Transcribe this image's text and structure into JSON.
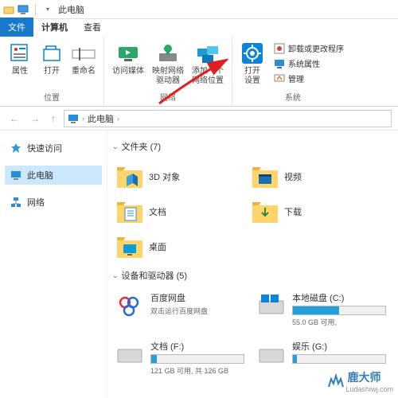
{
  "titlebar": {
    "title": "此电脑"
  },
  "tabs": {
    "file": "文件",
    "computer": "计算机",
    "view": "查看"
  },
  "ribbon": {
    "location": {
      "label": "位置",
      "properties": "属性",
      "open": "打开",
      "rename": "重命名"
    },
    "network": {
      "label": "网络",
      "media": "访问媒体",
      "mapdrive": "映射网络\n驱动器",
      "addloc": "添加一个\n网络位置"
    },
    "system": {
      "label": "系统",
      "opensettings": "打开\n设置",
      "uninstall": "卸载或更改程序",
      "sysprops": "系统属性",
      "manage": "管理"
    }
  },
  "breadcrumb": {
    "thispc": "此电脑"
  },
  "sidebar": {
    "quick": "快速访问",
    "thispc": "此电脑",
    "network": "网络"
  },
  "content": {
    "folders_hdr": "文件夹 (7)",
    "folders": [
      {
        "name": "3D 对象"
      },
      {
        "name": "视频"
      },
      {
        "name": "文档"
      },
      {
        "name": "下载"
      },
      {
        "name": "桌面"
      }
    ],
    "drives_hdr": "设备和驱动器 (5)",
    "drives": [
      {
        "name": "百度网盘",
        "sub": "双击运行百度网盘"
      },
      {
        "name": "本地磁盘 (C:)",
        "free": "55.0 GB 可用,",
        "fill": 50
      },
      {
        "name": "文档 (F:)",
        "free": "121 GB 可用, 共 126 GB",
        "fill": 6
      },
      {
        "name": "娱乐 (G:)",
        "free": "",
        "fill": 4
      }
    ]
  },
  "watermark": {
    "text": "鹿大师",
    "url": "Ludashiwj.com"
  }
}
